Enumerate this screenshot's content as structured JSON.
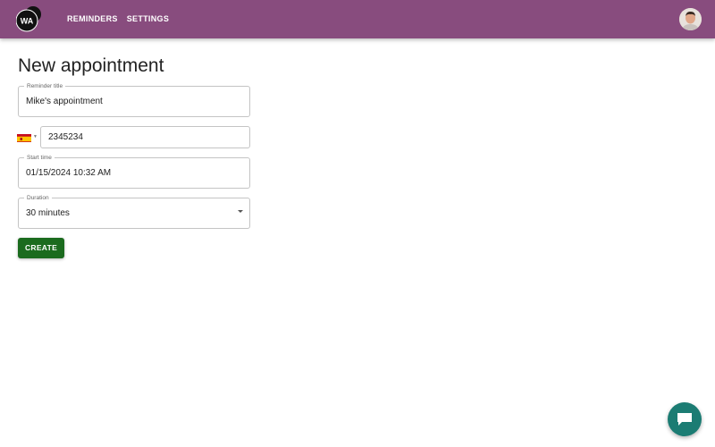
{
  "app": {
    "logo_text": "WA",
    "nav": [
      "REMINDERS",
      "SETTINGS"
    ],
    "avatar_icon": "user-avatar",
    "colors": {
      "appbar": "#884c7e",
      "create_button": "#1b6b1e",
      "chat_fab": "#1b7c73"
    }
  },
  "form": {
    "title": "New appointment",
    "reminder_title": {
      "label": "Reminder title",
      "value": "Mike's appointment"
    },
    "phone": {
      "country_flag": "spain-flag-icon",
      "value": "2345234"
    },
    "start_time": {
      "label": "Start time",
      "value": "01/15/2024 10:32 AM"
    },
    "duration": {
      "label": "Duration",
      "value": "30 minutes"
    },
    "create_label": "CREATE"
  },
  "chat": {
    "icon": "chat-bubble-icon"
  }
}
